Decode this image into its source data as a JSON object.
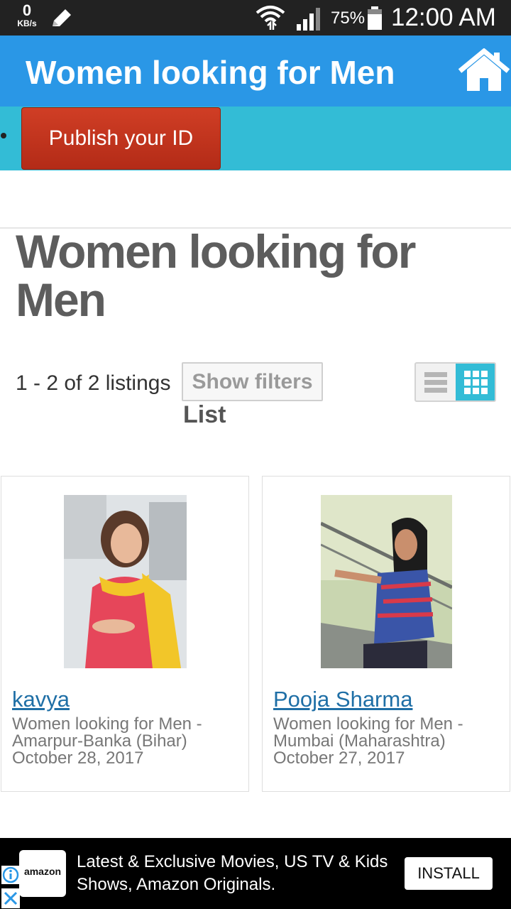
{
  "status_bar": {
    "speed_value": "0",
    "speed_unit": "KB/s",
    "battery": "75%",
    "time": "12:00 AM"
  },
  "app_bar": {
    "title": "Women looking for Men"
  },
  "actions": {
    "publish_label": "Publish your ID"
  },
  "page": {
    "title": "Women looking for Men",
    "listing_count": "1 - 2 of 2 listings",
    "show_filters_label": "Show filters",
    "list_label": "List"
  },
  "listings": [
    {
      "name": "kavya",
      "category": "Women looking for Men -",
      "location": "Amarpur-Banka (Bihar)",
      "date": "October 28, 2017"
    },
    {
      "name": "Pooja Sharma",
      "category": "Women looking for Men -",
      "location": "Mumbai (Maharashtra)",
      "date": "October 27, 2017"
    }
  ],
  "ad": {
    "brand": "amazon",
    "text": "Latest & Exclusive Movies, US TV & Kids Shows, Amazon Originals.",
    "install_label": "INSTALL"
  },
  "colors": {
    "app_bar": "#2a97e6",
    "strip": "#33bcd6",
    "publish_button": "#c0331c",
    "link": "#1f6fa6"
  }
}
